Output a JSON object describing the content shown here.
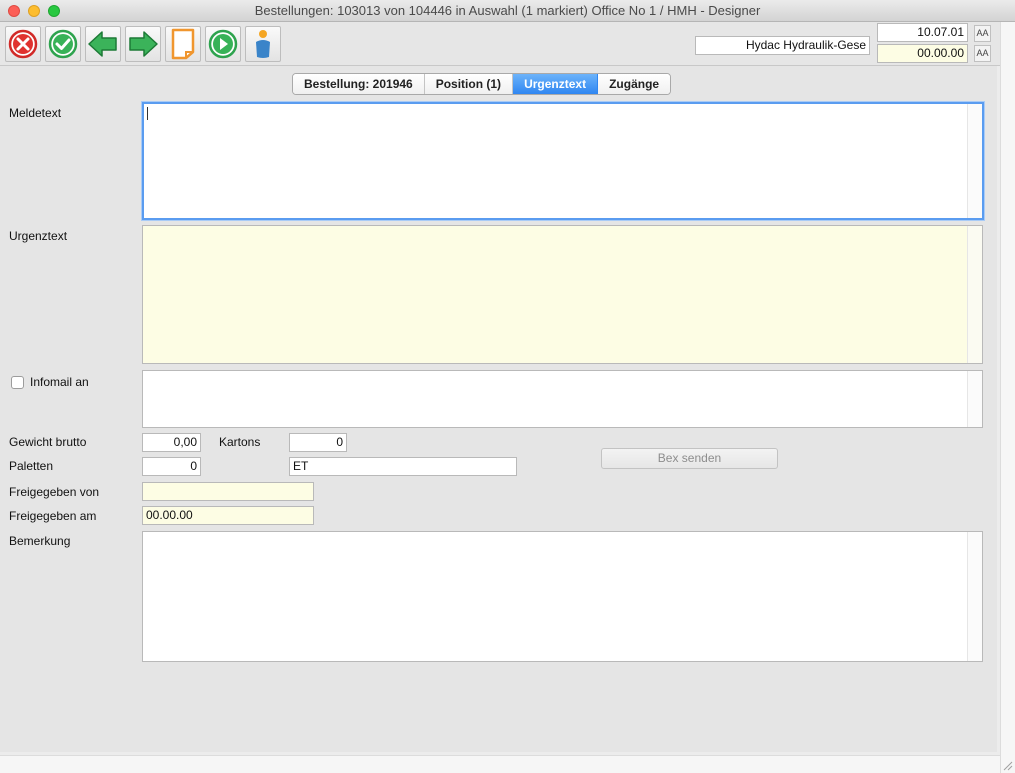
{
  "window": {
    "title": "Bestellungen: 103013 von 104446 in Auswahl  (1 markiert) Office No 1 /  HMH - Designer"
  },
  "toolbar": {
    "supplier_name": "Hydac Hydraulik-Gese",
    "date_value": "10.07.01",
    "time_value": "00.00.00",
    "font_larger_label": "AA",
    "font_smaller_label": "AA"
  },
  "tabs": [
    {
      "label": "Bestellung: 201946"
    },
    {
      "label": "Position (1)"
    },
    {
      "label": "Urgenztext"
    },
    {
      "label": "Zugänge"
    }
  ],
  "form": {
    "meldetext_label": "Meldetext",
    "meldetext_value": "",
    "urgenztext_label": "Urgenztext",
    "urgenztext_value": "",
    "infomail_label": "Infomail an",
    "infomail_value": "",
    "gewicht_label": "Gewicht brutto",
    "gewicht_value": "0,00",
    "kartons_label": "Kartons",
    "kartons_value": "0",
    "paletten_label": "Paletten",
    "paletten_value": "0",
    "einheit_value": "ET",
    "bex_button_label": "Bex senden",
    "freigegeben_von_label": "Freigegeben von",
    "freigegeben_von_value": "",
    "freigegeben_am_label": "Freigegeben am",
    "freigegeben_am_value": "00.00.00",
    "bemerkung_label": "Bemerkung",
    "bemerkung_value": ""
  },
  "colors": {
    "accent_tab": "#2f86f1",
    "focus_ring": "#5a9cf0",
    "readonly_yellow": "#fdfde4",
    "close_red": "#e0322f",
    "ok_green": "#2ea34e"
  }
}
